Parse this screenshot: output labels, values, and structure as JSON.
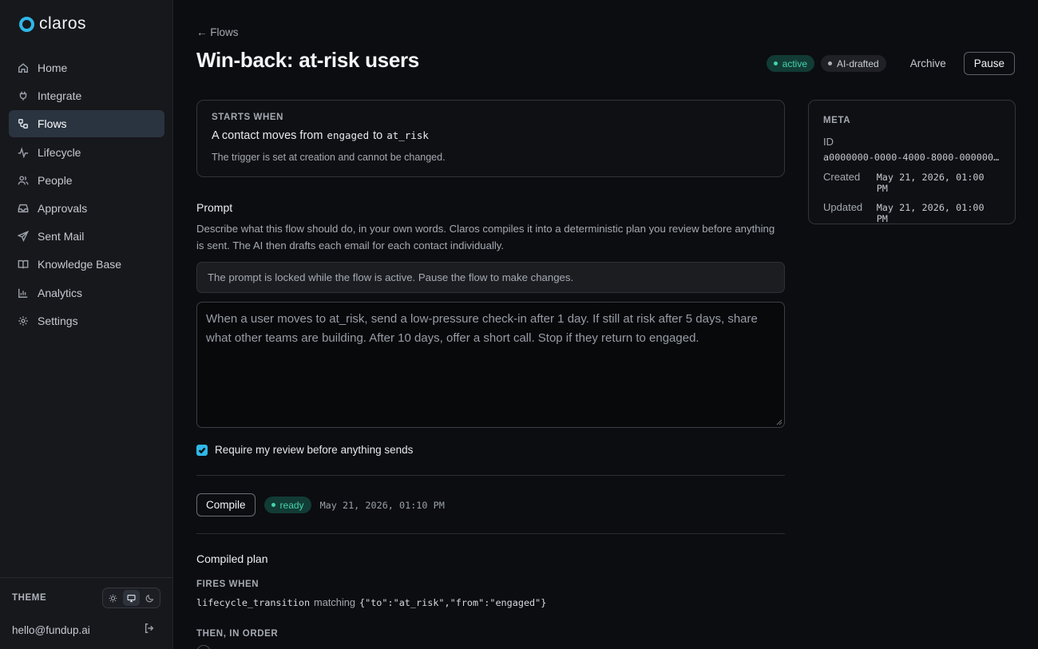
{
  "brand": {
    "name": "claros",
    "accent": "#2fb7e8"
  },
  "sidebar": {
    "items": [
      {
        "label": "Home",
        "icon": "home-icon"
      },
      {
        "label": "Integrate",
        "icon": "plug-icon"
      },
      {
        "label": "Flows",
        "icon": "flows-icon",
        "active": true
      },
      {
        "label": "Lifecycle",
        "icon": "pulse-icon"
      },
      {
        "label": "People",
        "icon": "people-icon"
      },
      {
        "label": "Approvals",
        "icon": "inbox-icon"
      },
      {
        "label": "Sent Mail",
        "icon": "send-icon"
      },
      {
        "label": "Knowledge Base",
        "icon": "book-icon"
      },
      {
        "label": "Analytics",
        "icon": "bar-chart-icon"
      },
      {
        "label": "Settings",
        "icon": "gear-icon"
      }
    ],
    "theme_label": "THEME",
    "theme_options": [
      "sun-icon",
      "monitor-icon",
      "moon-icon"
    ],
    "theme_selected": "monitor-icon",
    "user_email": "hello@fundup.ai"
  },
  "header": {
    "back_label": "← Flows",
    "title": "Win-back: at-risk users",
    "status_badge": "active",
    "ai_badge": "AI-drafted",
    "archive_label": "Archive",
    "pause_label": "Pause"
  },
  "starts_when": {
    "caption": "STARTS WHEN",
    "prefix": "A contact moves from",
    "from_state": "engaged",
    "connector": "to",
    "to_state": "at_risk",
    "note": "The trigger is set at creation and cannot be changed."
  },
  "meta": {
    "caption": "META",
    "id_label": "ID",
    "id_value": "a0000000-0000-4000-8000-000000…",
    "created_label": "Created",
    "created_value": "May 21, 2026, 01:00 PM",
    "updated_label": "Updated",
    "updated_value": "May 21, 2026, 01:00 PM"
  },
  "prompt": {
    "title": "Prompt",
    "description": "Describe what this flow should do, in your own words. Claros compiles it into a deterministic plan you review before anything is sent. The AI then drafts each email for each contact individually.",
    "locked_notice": "The prompt is locked while the flow is active. Pause the flow to make changes.",
    "value": "When a user moves to at_risk, send a low-pressure check-in after 1 day. If still at risk after 5 days, share what other teams are building. After 10 days, offer a short call. Stop if they return to engaged.",
    "require_review_label": "Require my review before anything sends",
    "require_review_checked": true
  },
  "compile": {
    "button_label": "Compile",
    "status": "ready",
    "timestamp": "May 21, 2026, 01:10 PM"
  },
  "plan": {
    "title": "Compiled plan",
    "fires_caption": "FIRES WHEN",
    "event": "lifecycle_transition",
    "matching_word": "matching",
    "matching_value": "{\"to\":\"at_risk\",\"from\":\"engaged\"}",
    "then_caption": "THEN, IN ORDER"
  },
  "colors": {
    "active_badge_bg": "#123b36",
    "active_badge_fg": "#46d3ac",
    "nav_active_bg": "#2a3440"
  }
}
